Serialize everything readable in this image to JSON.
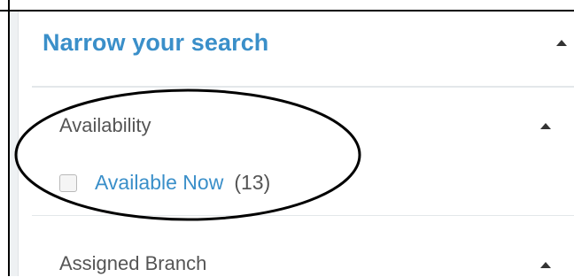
{
  "panel": {
    "title": "Narrow your search",
    "header_toggle_icon": "caret-up-icon"
  },
  "sections": {
    "availability": {
      "title": "Availability",
      "toggle_icon": "caret-up-icon",
      "options": [
        {
          "label": "Available Now",
          "count": "(13)",
          "checked": false
        }
      ]
    },
    "assigned_branch": {
      "title": "Assigned Branch",
      "toggle_icon": "caret-up-icon"
    }
  },
  "colors": {
    "accent": "#3a8fc9",
    "text": "#555555",
    "annotation": "#000000"
  }
}
